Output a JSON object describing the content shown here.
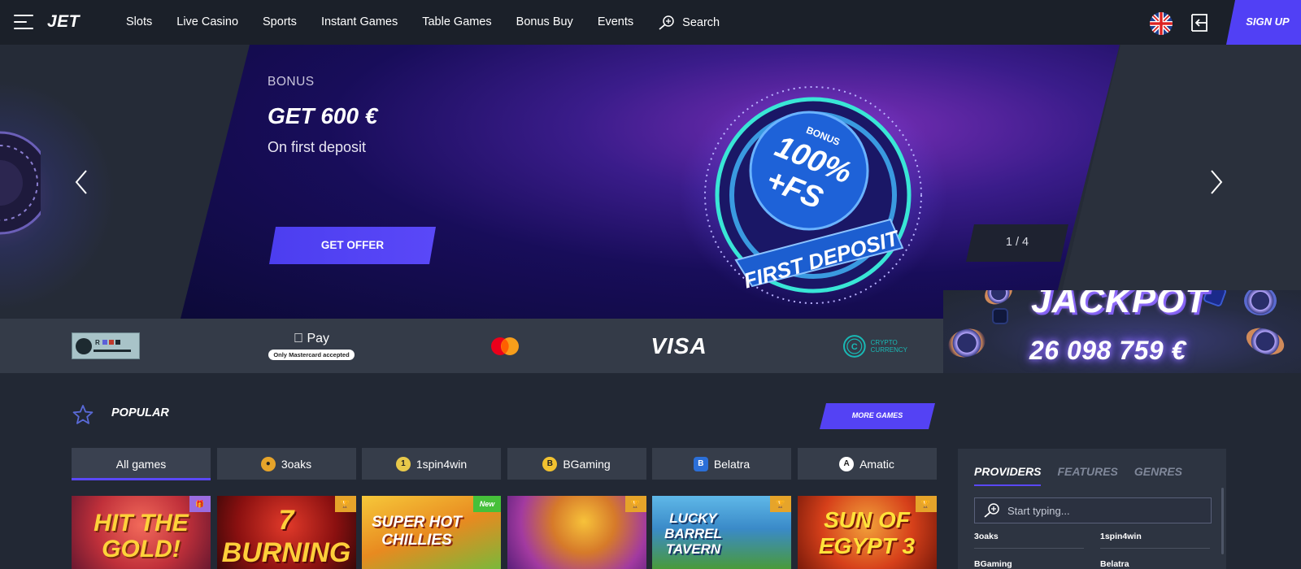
{
  "header": {
    "logo": "JET",
    "nav": [
      "Slots",
      "Live Casino",
      "Sports",
      "Instant Games",
      "Table Games",
      "Bonus Buy",
      "Events"
    ],
    "search_label": "Search",
    "signup_label": "SIGN UP"
  },
  "hero": {
    "kicker": "BONUS",
    "title": "GET 600 €",
    "subtitle": "On first deposit",
    "cta": "GET OFFER",
    "counter": "1 / 4",
    "promo_text": {
      "bonus": "BONUS",
      "main1": "100%",
      "main2": "+FS",
      "ring": "FIRST DEPOSIT"
    }
  },
  "payments": {
    "apple_pay": "Pay",
    "apple_pay_note": "Only Mastercard accepted",
    "visa": "VISA",
    "crypto": "CRYPTO",
    "crypto2": "CURRENCY"
  },
  "jackpot": {
    "title": "JACKPOT",
    "amount": "26 098 759 €"
  },
  "popular": {
    "title": "POPULAR",
    "more_games": "MORE GAMES",
    "filters": [
      {
        "label": "All games",
        "icon": ""
      },
      {
        "label": "3oaks",
        "icon": "3oaks-icon"
      },
      {
        "label": "1spin4win",
        "icon": "1spin4win-icon"
      },
      {
        "label": "BGaming",
        "icon": "bgaming-icon"
      },
      {
        "label": "Belatra",
        "icon": "belatra-icon"
      },
      {
        "label": "Amatic",
        "icon": "amatic-icon"
      }
    ],
    "games": [
      {
        "title": "HIT THE GOLD!",
        "tag": "gift"
      },
      {
        "title": "7 BURNING",
        "tag": "trophy"
      },
      {
        "title": "SUPER HOT CHILLIES",
        "tag": "New"
      },
      {
        "title": "",
        "tag": "trophy"
      },
      {
        "title": "LUCKY BARREL TAVERN",
        "tag": "trophy"
      },
      {
        "title": "SUN OF EGYPT 3",
        "tag": "trophy"
      }
    ]
  },
  "providers": {
    "tabs": [
      "PROVIDERS",
      "FEATURES",
      "GENRES"
    ],
    "search_placeholder": "Start typing...",
    "list": [
      "3oaks",
      "1spin4win",
      "BGaming",
      "Belatra"
    ]
  }
}
